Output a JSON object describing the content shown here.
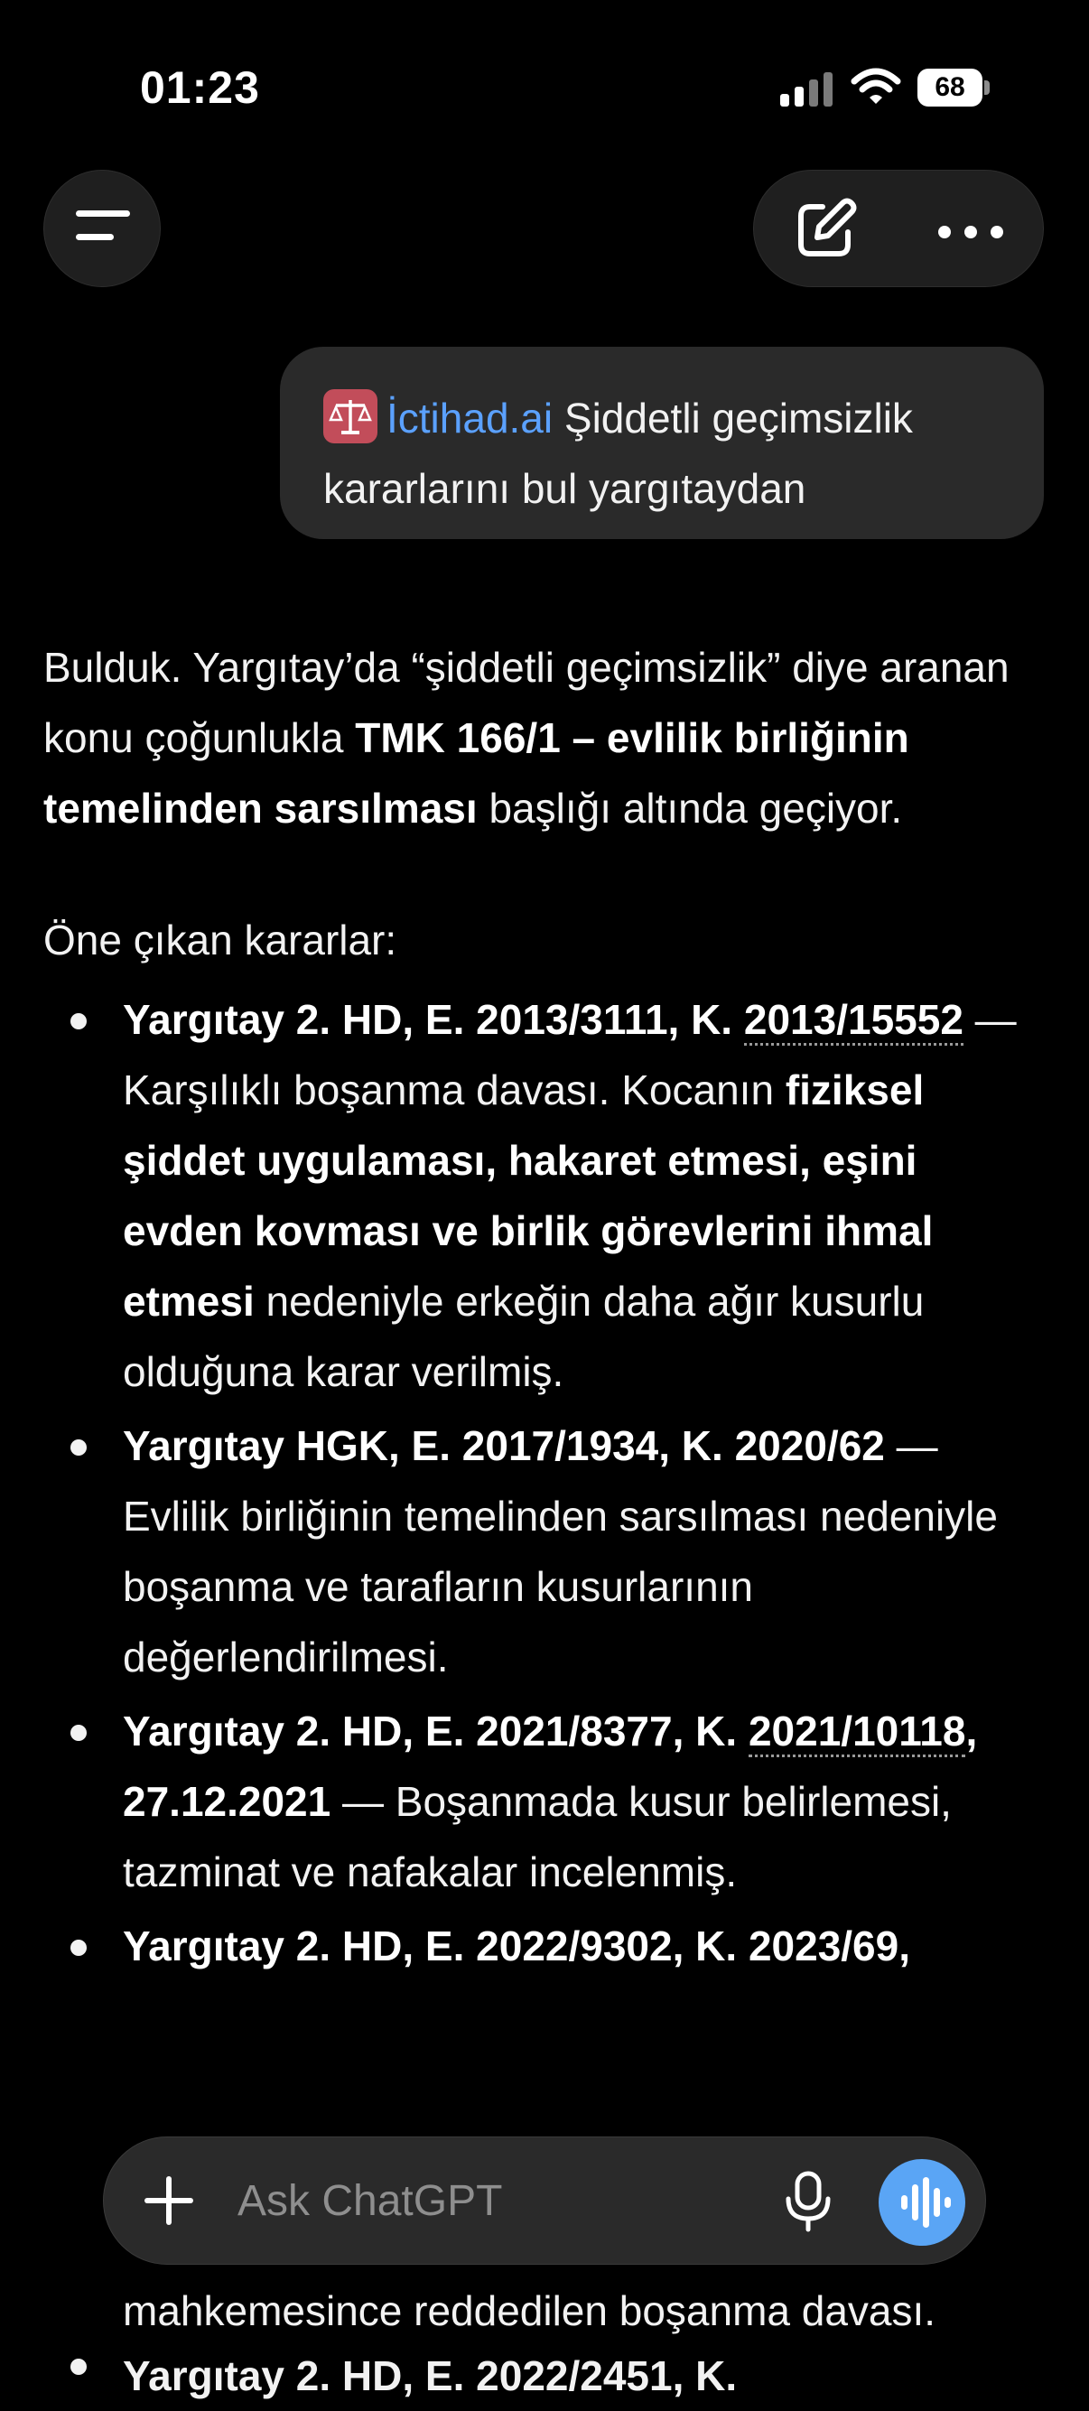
{
  "status": {
    "time": "01:23",
    "battery": "68"
  },
  "header": {
    "menu_icon": "menu-icon",
    "edit_icon": "new-chat-icon",
    "more_icon": "more-icon"
  },
  "user_message": {
    "mention": "İctihad.ai",
    "text_part1": " Şiddetli geçimsizlik",
    "text_part2": "kararlarını bul yargıtaydan",
    "mention_icon": "scales-icon"
  },
  "answer": {
    "intro": {
      "t1": "Bulduk. Yargıtay’da “şiddetli geçimsizlik” diye aranan konu çoğunlukla ",
      "b1": "TMK 166/1 – evlilik birliğinin temelinden sarsılması",
      "t2": " başlığı altında geçiyor."
    },
    "list_heading": "Öne çıkan kararlar:",
    "items": [
      {
        "b_pre": "Yargıtay 2. HD, E. 2013/3111, K. ",
        "cite": "2013/15552",
        "t1": " — Karşılıklı boşanma davası. Kocanın ",
        "b2": "fiziksel şiddet uygulaması, hakaret etmesi, eşini evden kovması ve birlik görevlerini ihmal etmesi",
        "t2": " nedeniyle erkeğin daha ağır kusurlu olduğuna karar verilmiş."
      },
      {
        "b_pre": "Yargıtay HGK, E. 2017/1934, K. 2020/62",
        "t1": " — Evlilik birliğinin temelinden sarsılması nedeniyle boşanma ve tarafların kusurlarının değerlendirilmesi."
      },
      {
        "b_pre": "Yargıtay 2. HD, E. 2021/8377, K. ",
        "cite": "2021/10118",
        "b_post": ", 27.12.2021",
        "t1": " — Boşanmada kusur belirlemesi, tazminat ve nafakalar incelenmiş."
      },
      {
        "b_pre": "Yargıtay 2. HD, E. 2022/9302, K. 2023/69,"
      }
    ],
    "tail_line": "mahkemesince reddedilen boşanma davası.",
    "tail_cut": "Yargıtay 2. HD, E. 2022/2451, K."
  },
  "composer": {
    "placeholder": "Ask ChatGPT",
    "plus_icon": "plus-icon",
    "mic_icon": "microphone-icon",
    "voice_icon": "voice-mode-icon"
  }
}
